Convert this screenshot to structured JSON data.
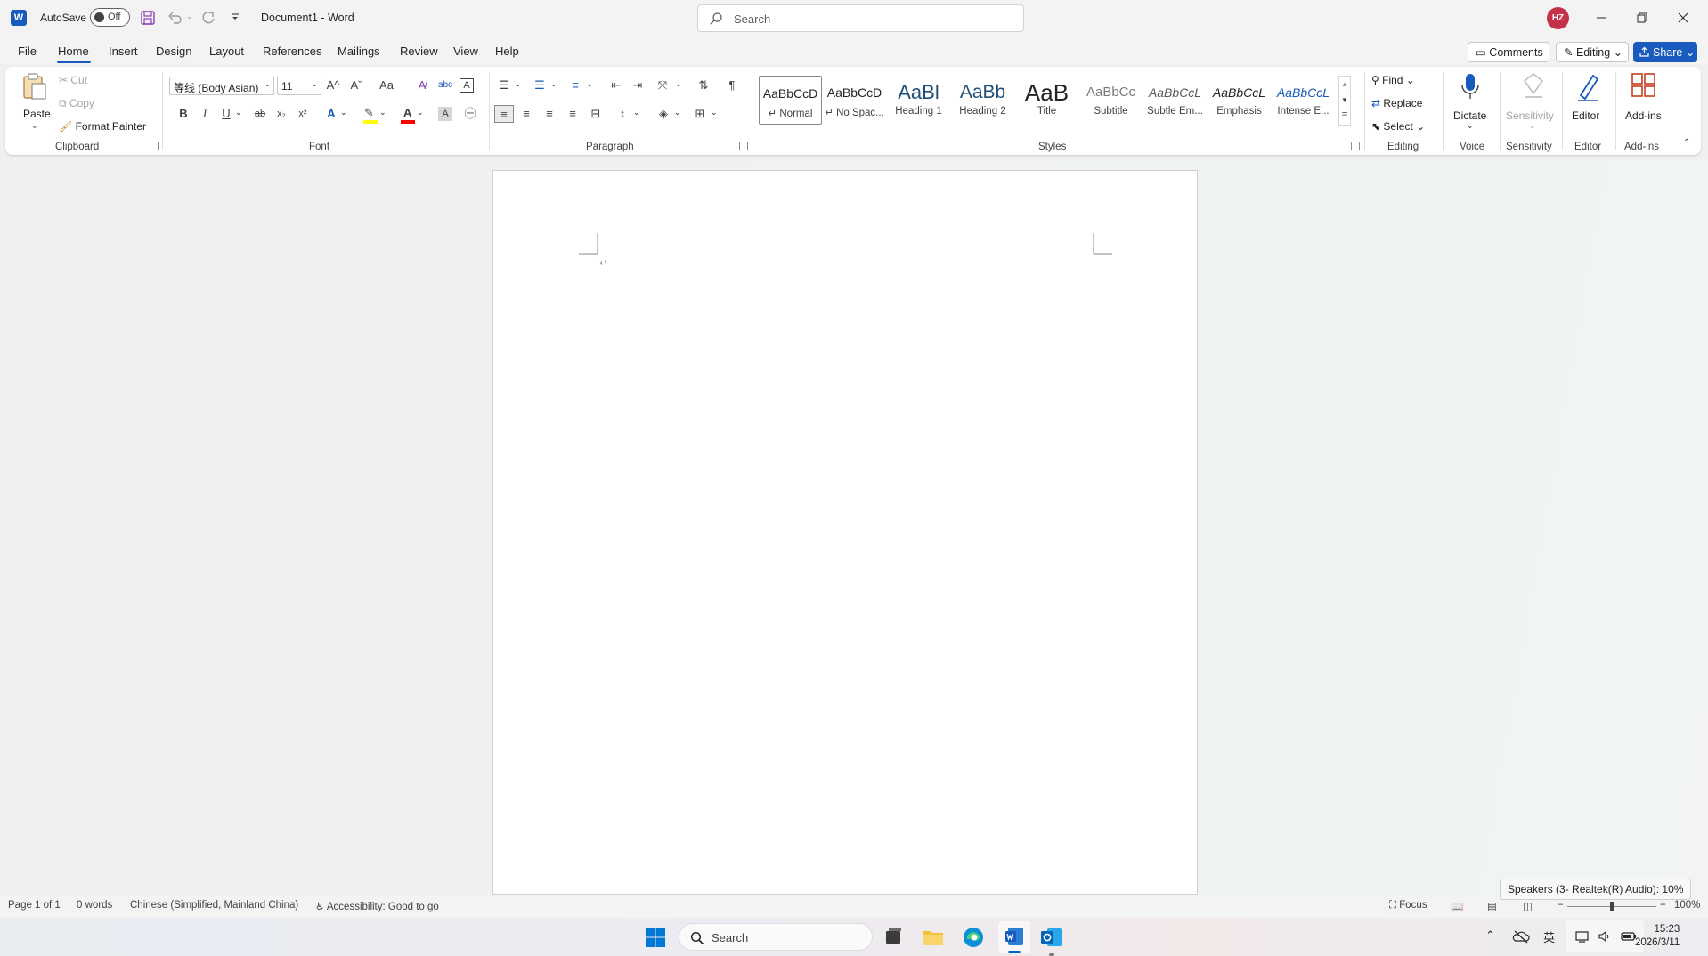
{
  "titlebar": {
    "app_logo_letter": "W",
    "autosave_label": "AutoSave",
    "autosave_state": "Off",
    "document_title": "Document1",
    "separator": "-",
    "app_name": "Word",
    "search_placeholder": "Search",
    "user_initials": "HZ"
  },
  "tabs": {
    "items": [
      "File",
      "Home",
      "Insert",
      "Design",
      "Layout",
      "References",
      "Mailings",
      "Review",
      "View",
      "Help"
    ],
    "active": "Home",
    "comments_label": "Comments",
    "editing_label": "Editing",
    "share_label": "Share"
  },
  "ribbon": {
    "clipboard": {
      "paste": "Paste",
      "cut": "Cut",
      "copy": "Copy",
      "format_painter": "Format Painter",
      "label": "Clipboard"
    },
    "font": {
      "font_name": "等线 (Body Asian)",
      "font_size": "11",
      "grow": "A^",
      "shrink": "Aˇ",
      "change_case": "Aa",
      "bold": "B",
      "italic": "I",
      "underline": "U",
      "strike": "ab",
      "subscript": "x₂",
      "superscript": "x²",
      "label": "Font",
      "highlight_color": "#ffff00",
      "font_color": "#ff0000"
    },
    "paragraph": {
      "label": "Paragraph"
    },
    "styles": {
      "items": [
        {
          "preview": "AaBbCcD",
          "name": "↵ Normal"
        },
        {
          "preview": "AaBbCcD",
          "name": "↵ No Spac..."
        },
        {
          "preview": "AaBl",
          "name": "Heading 1"
        },
        {
          "preview": "AaBb",
          "name": "Heading 2"
        },
        {
          "preview": "AaB",
          "name": "Title"
        },
        {
          "preview": "AaBbCc",
          "name": "Subtitle"
        },
        {
          "preview": "AaBbCcL",
          "name": "Subtle Em..."
        },
        {
          "preview": "AaBbCcL",
          "name": "Emphasis"
        },
        {
          "preview": "AaBbCcL",
          "name": "Intense E..."
        }
      ],
      "label": "Styles"
    },
    "editing": {
      "find": "Find",
      "replace": "Replace",
      "select": "Select",
      "label": "Editing"
    },
    "voice": {
      "dictate": "Dictate",
      "label": "Voice"
    },
    "sensitivity": {
      "button": "Sensitivity",
      "label": "Sensitivity"
    },
    "editor": {
      "button": "Editor",
      "label": "Editor"
    },
    "addins": {
      "button": "Add-ins",
      "label": "Add-ins"
    },
    "accent_color": "#185abd"
  },
  "document": {
    "paragraph_mark": "↵"
  },
  "statusbar": {
    "page": "Page 1 of 1",
    "words": "0 words",
    "language": "Chinese (Simplified, Mainland China)",
    "accessibility": "Accessibility: Good to go",
    "focus": "Focus",
    "zoom": "100%",
    "zoom_minus": "−",
    "zoom_plus": "+"
  },
  "tooltip": {
    "text": "Speakers (3- Realtek(R) Audio): 10%"
  },
  "taskbar": {
    "search_label": "Search",
    "ime": "英",
    "time": "15:23",
    "date": "2026/3/11"
  }
}
